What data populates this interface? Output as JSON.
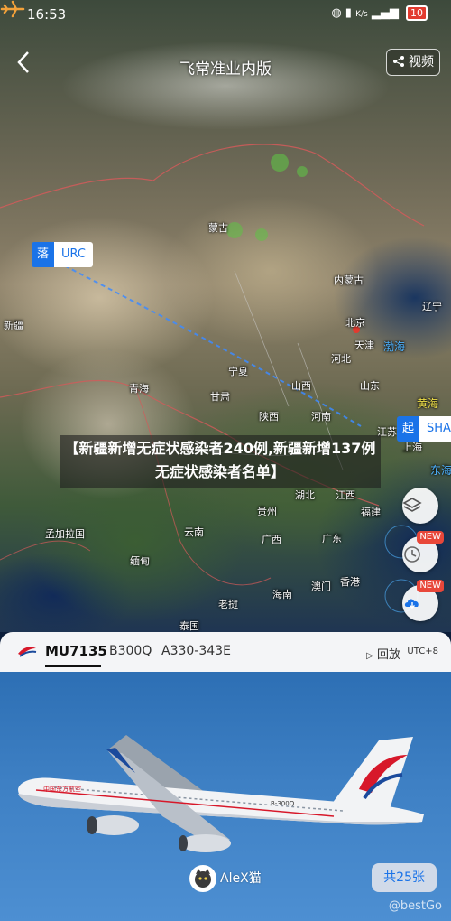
{
  "status_bar": {
    "time": "16:53",
    "network": "K/s",
    "battery": "10"
  },
  "header": {
    "title": "飞常准业内版",
    "video_label": "视频"
  },
  "map": {
    "origin": {
      "tag": "落",
      "code": "URC"
    },
    "destination": {
      "tag": "起",
      "code": "SHA"
    },
    "labels": {
      "mongolia": "蒙古",
      "inner_mongolia": "内蒙古",
      "liaoning": "辽宁",
      "xinjiang": "新疆",
      "beijing": "北京",
      "tianjin": "天津",
      "bohai": "渤海",
      "hebei": "河北",
      "ningxia": "宁夏",
      "qinghai": "青海",
      "gansu": "甘肃",
      "shanxi": "山西",
      "shandong": "山东",
      "yellow_sea": "黄海",
      "shaanxi": "陕西",
      "henan": "河南",
      "jiangsu": "江苏",
      "shanghai": "上海",
      "east_sea": "东海",
      "hubei": "湖北",
      "jiangxi": "江西",
      "guizhou": "贵州",
      "fujian": "福建",
      "bangladesh": "孟加拉国",
      "yunnan": "云南",
      "guangxi": "广西",
      "guangdong": "广东",
      "myanmar": "缅甸",
      "macau": "澳门",
      "hongkong": "香港",
      "hainan": "海南",
      "laos": "老挝",
      "thailand": "泰国"
    },
    "headline": "【新疆新增无症状感染者240例,新疆新增137例无症状感染者名单】",
    "side_buttons": {
      "history_badge": "NEW",
      "download_badge": "NEW"
    }
  },
  "flight": {
    "number": "MU7135",
    "registration": "B300Q",
    "aircraft_type": "A330-343E",
    "replay_label": "回放",
    "timezone": "UTC+8"
  },
  "photo": {
    "photographer": "AleX猫",
    "count_label": "共25张",
    "watermark": "@bestGo",
    "livery": {
      "body_text": "B-300Q",
      "airline_cn": "中国东方航空"
    }
  },
  "colors": {
    "accent": "#1a73e8",
    "airline_red": "#d7182a",
    "airline_blue": "#1b4a9c"
  }
}
